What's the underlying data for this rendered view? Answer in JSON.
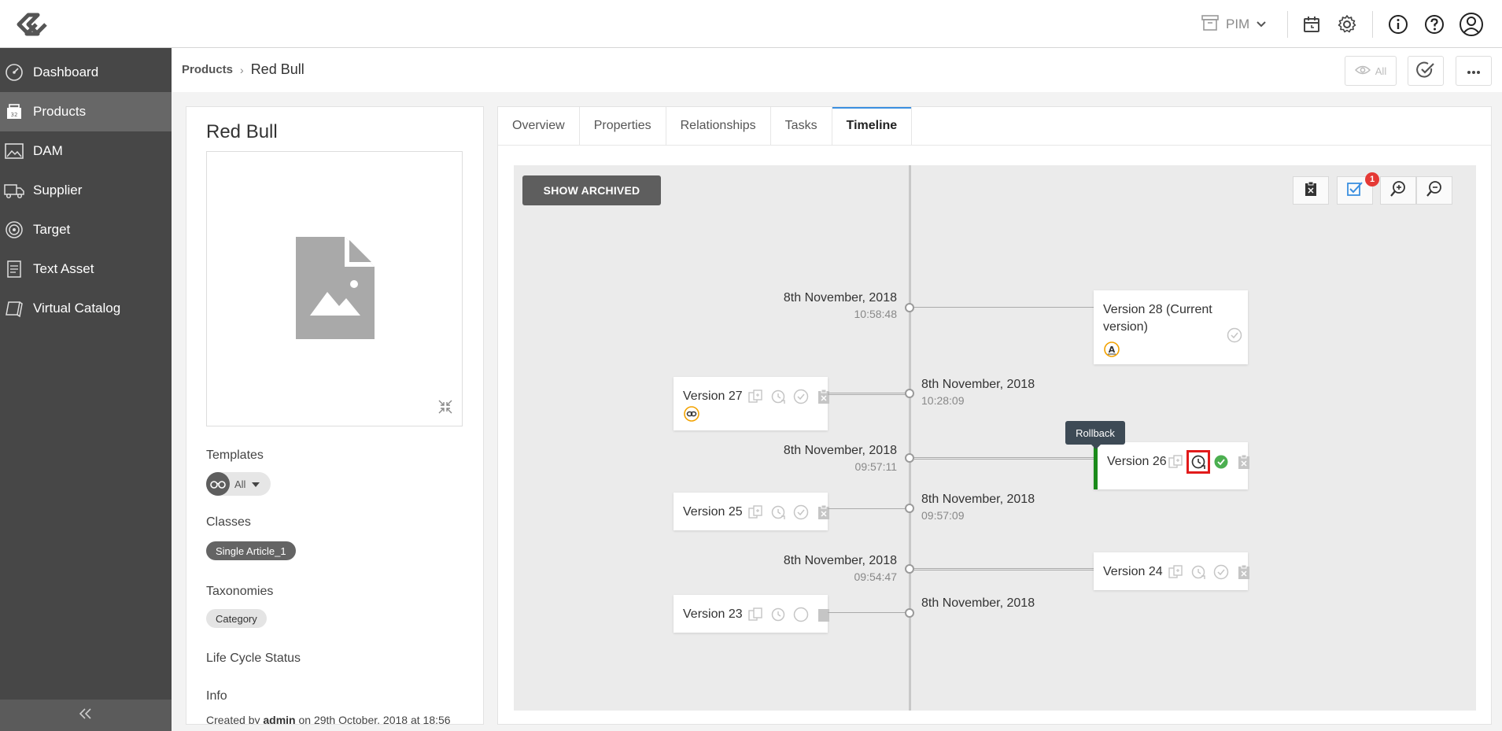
{
  "topbar": {
    "app_switch": "PIM",
    "icons": [
      "logo-icon",
      "archive-icon",
      "chevron-down-icon",
      "calendar-clock-icon",
      "gear-icon",
      "info-icon",
      "help-icon",
      "user-icon"
    ]
  },
  "sidebar": {
    "items": [
      {
        "label": "Dashboard",
        "icon": "dashboard-icon"
      },
      {
        "label": "Products",
        "icon": "products-icon",
        "active": true
      },
      {
        "label": "DAM",
        "icon": "image-icon"
      },
      {
        "label": "Supplier",
        "icon": "truck-icon"
      },
      {
        "label": "Target",
        "icon": "target-icon"
      },
      {
        "label": "Text Asset",
        "icon": "document-icon"
      },
      {
        "label": "Virtual Catalog",
        "icon": "catalog-icon"
      }
    ]
  },
  "header": {
    "breadcrumb_root": "Products",
    "breadcrumb_sep": "›",
    "breadcrumb_current": "Red Bull",
    "view_filter": "All"
  },
  "product": {
    "title": "Red Bull",
    "templates_label": "Templates",
    "template_value": "All",
    "classes_label": "Classes",
    "class_chip": "Single Article_1",
    "taxonomies_label": "Taxonomies",
    "taxonomy_chip": "Category",
    "lifecycle_label": "Life Cycle Status",
    "info_label": "Info",
    "info_created_prefix": "Created by",
    "info_user": "admin",
    "info_on": "on",
    "info_date": "29th October, 2018",
    "info_at": "at",
    "info_time": "18:56"
  },
  "tabs": [
    "Overview",
    "Properties",
    "Relationships",
    "Tasks",
    "Timeline"
  ],
  "active_tab": "Timeline",
  "timeline": {
    "show_archived": "SHOW ARCHIVED",
    "task_badge": "1",
    "tooltip": "Rollback",
    "entries": [
      {
        "version": "Version 28 (Current version)",
        "date": "8th November, 2018",
        "time": "10:58:48"
      },
      {
        "version": "Version 27",
        "date": "8th November, 2018",
        "time": "10:28:09"
      },
      {
        "version": "Version 26",
        "date": "8th November, 2018",
        "time": "09:57:11"
      },
      {
        "version": "Version 25",
        "date": "8th November, 2018",
        "time": "09:57:09"
      },
      {
        "version": "Version 24",
        "date": "8th November, 2018",
        "time": "09:54:47"
      },
      {
        "version": "Version 23",
        "date": "8th November, 2018",
        "time": ""
      }
    ]
  },
  "colors": {
    "sidebar_bg": "#474747",
    "sidebar_active": "#676767",
    "accent_tab": "#3b8fe0",
    "highlight_bar": "#1a8a1a",
    "badge": "#e53935",
    "focus_outline": "#e11b1b",
    "indicator_orange": "#f2a200"
  }
}
